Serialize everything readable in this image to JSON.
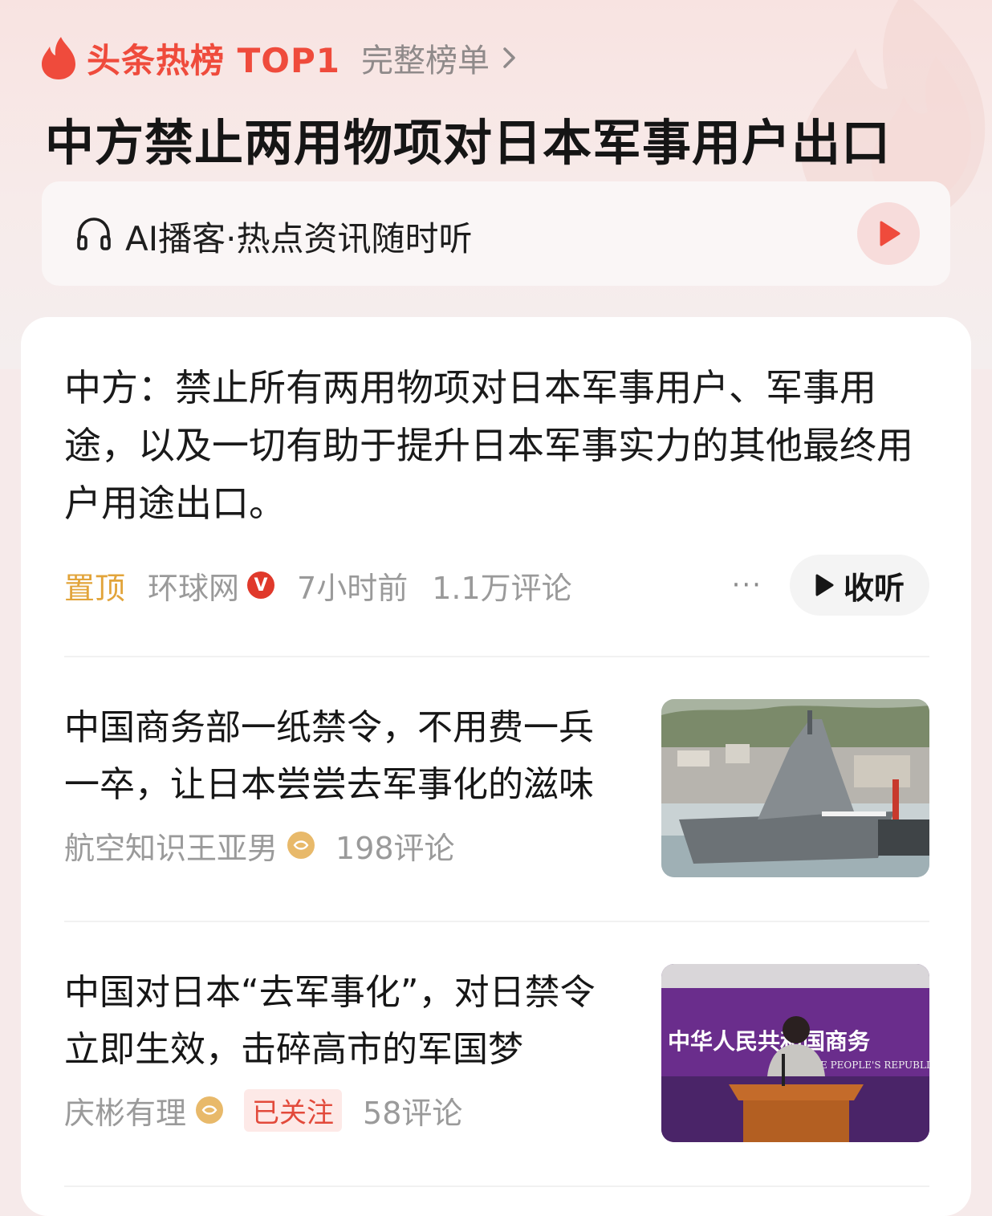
{
  "hot_list": {
    "label": "头条热榜 TOP1",
    "full_list_label": "完整榜单",
    "headline": "中方禁止两用物项对日本军事用户出口"
  },
  "podcast": {
    "label": "AI播客·热点资讯随时听"
  },
  "lead_article": {
    "text": "中方：禁止所有两用物项对日本军事用户、军事用途，以及一切有助于提升日本军事实力的其他最终用户用途出口。",
    "pin_label": "置顶",
    "source": "环球网",
    "verified_badge": "V",
    "time": "7小时前",
    "comments": "1.1万评论",
    "more": "···",
    "listen_label": "收听"
  },
  "articles": [
    {
      "title": "中国商务部一纸禁令，不用费一兵一卒，让日本尝尝去军事化的滋味",
      "author": "航空知识王亚男",
      "comments": "198评论"
    },
    {
      "title": "中国对日本“去军事化”，对日禁令立即生效，击碎高市的军国梦",
      "author": "庆彬有理",
      "follow_status": "已关注",
      "comments": "58评论",
      "image_banner_text": "中华人民共和国商务",
      "image_banner_subtext": "E PEOPLE'S REPUBLIC"
    }
  ],
  "colors": {
    "accent_red": "#ef4b3c",
    "pin_gold": "#e2a43a",
    "meta_gray": "#9a9a9a"
  },
  "icons": [
    "flame-icon",
    "chevron-right-icon",
    "headphones-icon",
    "play-icon",
    "verified-icon",
    "more-icon"
  ]
}
